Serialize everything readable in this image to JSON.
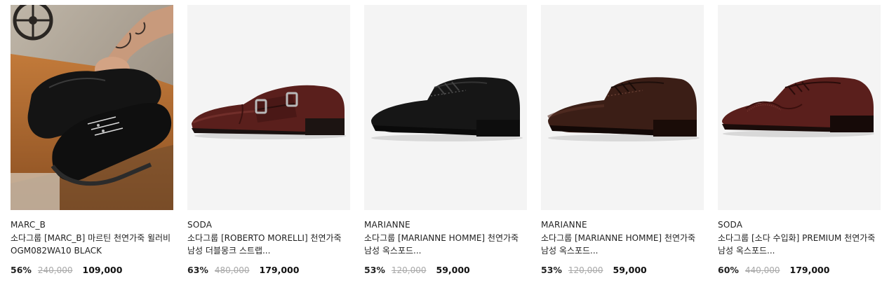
{
  "products": [
    {
      "brand": "MARC_B",
      "name": "소다그룹 [MARC_B] 마르틴 천연가죽 윌러비 OGM082WA10 BLACK",
      "discount": "56%",
      "original_price": "240,000",
      "price": "109,000",
      "image": "black-moccasin-boot-lifestyle-photo"
    },
    {
      "brand": "SODA",
      "name": "소다그룹 [ROBERTO MORELLI] 천연가죽 남성 더블몽크 스트랩...",
      "discount": "63%",
      "original_price": "480,000",
      "price": "179,000",
      "image": "burgundy-double-monk-strap-shoe"
    },
    {
      "brand": "MARIANNE",
      "name": "소다그룹 [MARIANNE HOMME] 천연가죽 남성 옥스포드...",
      "discount": "53%",
      "original_price": "120,000",
      "price": "59,000",
      "image": "black-derby-oxford-shoe"
    },
    {
      "brand": "MARIANNE",
      "name": "소다그룹 [MARIANNE HOMME] 천연가죽 남성 옥스포드...",
      "discount": "53%",
      "original_price": "120,000",
      "price": "59,000",
      "image": "dark-brown-derby-oxford-shoe"
    },
    {
      "brand": "SODA",
      "name": "소다그룹 [소다 수입화] PREMIUM 천연가죽 남성 옥스포드...",
      "discount": "60%",
      "original_price": "440,000",
      "price": "179,000",
      "image": "burgundy-wingtip-derby-shoe"
    }
  ],
  "colors": {
    "black_leather": "#1a1a1a",
    "burgundy_leather": "#5a1f1c",
    "dark_brown_leather": "#3b1e16",
    "thumb_bg": "#f4f4f4"
  }
}
